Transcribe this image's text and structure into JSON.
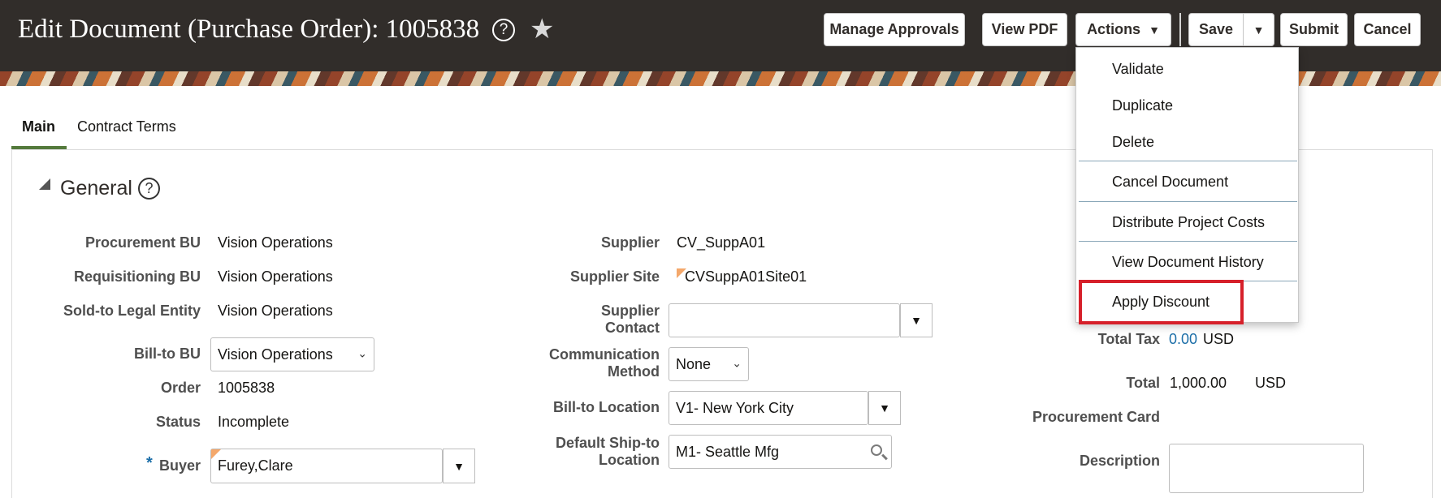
{
  "header": {
    "title": "Edit Document (Purchase Order): 1005838",
    "buttons": {
      "manage_approvals": "Manage Approvals",
      "view_pdf": "View PDF",
      "actions": "Actions",
      "save": "Save",
      "submit": "Submit",
      "cancel": "Cancel"
    }
  },
  "tabs": [
    {
      "label": "Main",
      "active": true
    },
    {
      "label": "Contract Terms",
      "active": false
    }
  ],
  "section": {
    "title": "General"
  },
  "left_fields": {
    "procurement_bu": {
      "label": "Procurement BU",
      "value": "Vision Operations"
    },
    "requisitioning_bu": {
      "label": "Requisitioning BU",
      "value": "Vision Operations"
    },
    "sold_to": {
      "label": "Sold-to Legal Entity",
      "value": "Vision Operations"
    },
    "bill_to_bu": {
      "label": "Bill-to BU",
      "value": "Vision Operations"
    },
    "order": {
      "label": "Order",
      "value": "1005838"
    },
    "status": {
      "label": "Status",
      "value": "Incomplete"
    },
    "buyer": {
      "label": "Buyer",
      "required_mark": "*",
      "value": "Furey,Clare"
    }
  },
  "mid_fields": {
    "supplier": {
      "label": "Supplier",
      "value": "CV_SuppA01"
    },
    "supplier_site": {
      "label": "Supplier Site",
      "value": "CVSuppA01Site01"
    },
    "supplier_contact": {
      "label_line1": "Supplier",
      "label_line2": "Contact",
      "value": ""
    },
    "communication_method": {
      "label_line1": "Communication",
      "label_line2": "Method",
      "value": "None"
    },
    "bill_to_location": {
      "label": "Bill-to Location",
      "value": "V1- New York City"
    },
    "ship_to_location": {
      "label_line1": "Default Ship-to",
      "label_line2": "Location",
      "value": "M1- Seattle Mfg"
    }
  },
  "right_fields": {
    "total_tax": {
      "label": "Total Tax",
      "value": "0.00",
      "currency": "USD"
    },
    "total": {
      "label": "Total",
      "value": "1,000.00",
      "currency": "USD"
    },
    "procurement_card": {
      "label": "Procurement Card"
    },
    "description": {
      "label": "Description",
      "value": ""
    }
  },
  "actions_menu": {
    "items": [
      "Validate",
      "Duplicate",
      "Delete",
      "Cancel Document",
      "Distribute Project Costs",
      "View Document History",
      "Apply Discount"
    ],
    "highlighted": "Apply Discount"
  },
  "colors": {
    "header_bg": "#312d2a",
    "tab_accent": "#547a3c",
    "link": "#1b6ea8",
    "highlight_box": "#d6202a"
  }
}
